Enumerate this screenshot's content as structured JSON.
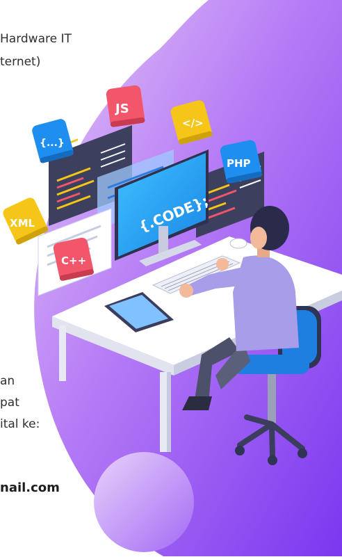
{
  "text": {
    "line1": "Hardware IT",
    "line2": "ternet)",
    "line3": "an",
    "line4": "pat",
    "line5": "ital ke:",
    "email": "nail.com"
  },
  "badges": {
    "js": "JS",
    "braces": "{...}",
    "tag": "</>",
    "php": "PHP",
    "xml": "XML",
    "cpp": "C++"
  },
  "monitor": {
    "code_text": "{.CODE};"
  },
  "colors": {
    "purple_light": "#d7b8f5",
    "purple_dark": "#7b3cf0",
    "accent_blue": "#1e8ff0",
    "accent_red": "#f1566a",
    "accent_yellow": "#f5c518"
  }
}
